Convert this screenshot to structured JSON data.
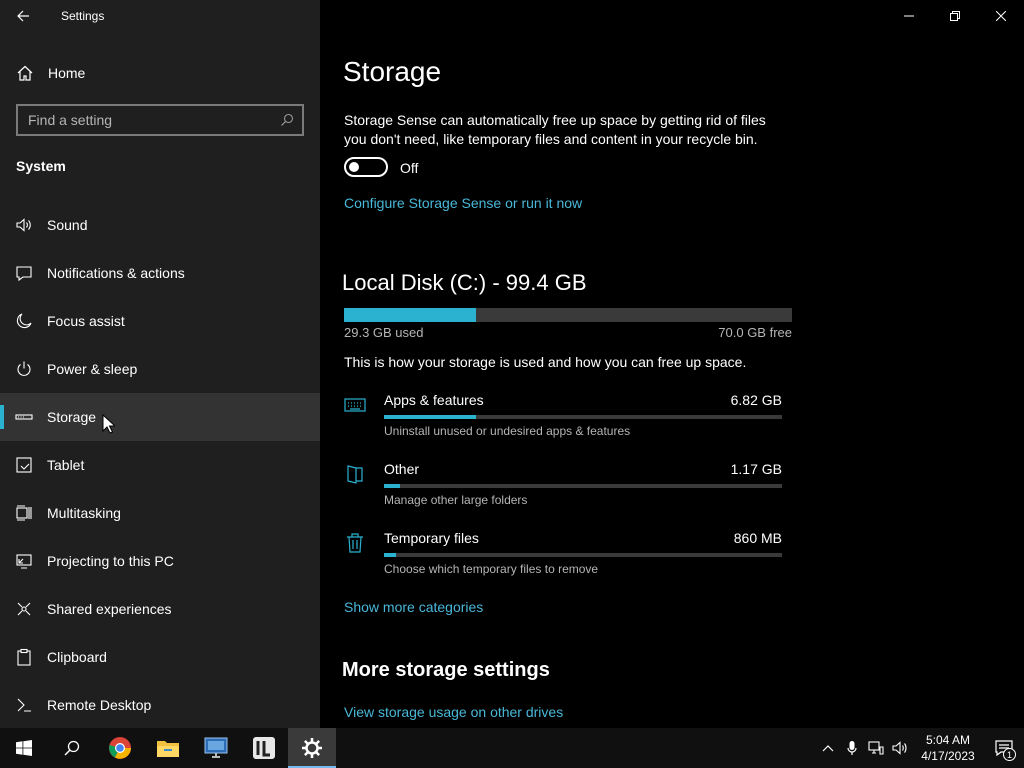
{
  "window": {
    "title": "Settings"
  },
  "sidebar": {
    "home_label": "Home",
    "search_placeholder": "Find a setting",
    "section_title": "System",
    "items": [
      {
        "label": "Sound",
        "icon": "speaker-icon"
      },
      {
        "label": "Notifications & actions",
        "icon": "notification-icon"
      },
      {
        "label": "Focus assist",
        "icon": "moon-icon"
      },
      {
        "label": "Power & sleep",
        "icon": "power-icon"
      },
      {
        "label": "Storage",
        "icon": "storage-icon",
        "active": true
      },
      {
        "label": "Tablet",
        "icon": "tablet-icon"
      },
      {
        "label": "Multitasking",
        "icon": "multitasking-icon"
      },
      {
        "label": "Projecting to this PC",
        "icon": "projecting-icon"
      },
      {
        "label": "Shared experiences",
        "icon": "shared-icon"
      },
      {
        "label": "Clipboard",
        "icon": "clipboard-icon"
      },
      {
        "label": "Remote Desktop",
        "icon": "remote-desktop-icon"
      }
    ]
  },
  "main": {
    "title": "Storage",
    "storage_sense": {
      "description": "Storage Sense can automatically free up space by getting rid of files you don't need, like temporary files and content in your recycle bin.",
      "toggle_state": "Off",
      "configure_link": "Configure Storage Sense or run it now"
    },
    "disk": {
      "title": "Local Disk (C:) - 99.4 GB",
      "used_label": "29.3 GB used",
      "free_label": "70.0 GB free",
      "used_fraction": 0.295,
      "description": "This is how your storage is used and how you can free up space."
    },
    "categories": [
      {
        "name": "Apps & features",
        "size": "6.82 GB",
        "sub": "Uninstall unused or undesired apps & features",
        "fraction": 0.23,
        "icon": "keyboard-icon"
      },
      {
        "name": "Other",
        "size": "1.17 GB",
        "sub": "Manage other large folders",
        "fraction": 0.04,
        "icon": "folder-icon"
      },
      {
        "name": "Temporary files",
        "size": "860 MB",
        "sub": "Choose which temporary files to remove",
        "fraction": 0.03,
        "icon": "trash-icon"
      }
    ],
    "show_more_link": "Show more categories",
    "more_settings_title": "More storage settings",
    "view_drives_link": "View storage usage on other drives"
  },
  "taskbar": {
    "time": "5:04 AM",
    "date": "4/17/2023",
    "notification_count": "1",
    "apps": [
      "start-icon",
      "search-icon",
      "chrome-icon",
      "file-explorer-icon",
      "remote-desktop-app-icon",
      "app-icon",
      "settings-icon"
    ]
  },
  "colors": {
    "accent": "#2bb2d1",
    "link": "#49b7d8",
    "sidebar_bg": "#1f1f1f",
    "main_bg": "#000000"
  }
}
